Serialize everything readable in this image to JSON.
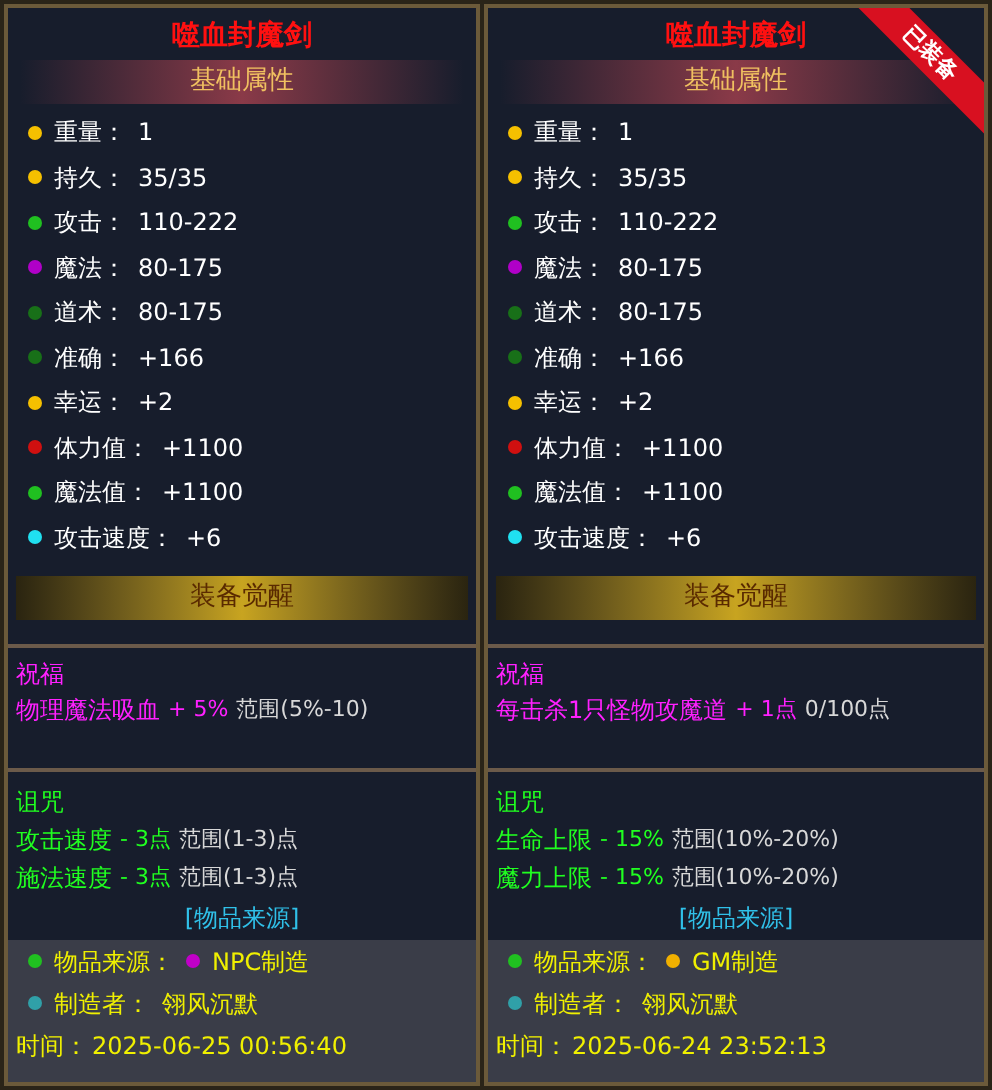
{
  "panels": [
    {
      "title": "噬血封魔剑",
      "basic_header": "基础属性",
      "stats": [
        {
          "label": "重量：",
          "value": "1",
          "color": "#f5c000"
        },
        {
          "label": "持久：",
          "value": "35/35",
          "color": "#f5c000"
        },
        {
          "label": "攻击：",
          "value": "110-222",
          "color": "#20c020"
        },
        {
          "label": "魔法：",
          "value": "80-175",
          "color": "#b000c8"
        },
        {
          "label": "道术：",
          "value": "80-175",
          "color": "#187018"
        },
        {
          "label": "准确：",
          "value": "+166",
          "color": "#187018"
        },
        {
          "label": "幸运：",
          "value": "+2",
          "color": "#f5c000"
        },
        {
          "label": "体力值：",
          "value": "+1100",
          "color": "#d01010"
        },
        {
          "label": "魔法值：",
          "value": "+1100",
          "color": "#20c020"
        },
        {
          "label": "攻击速度：",
          "value": "+6",
          "color": "#20e0f0"
        }
      ],
      "awakening": "装备觉醒",
      "blessing": {
        "title": "祝福",
        "lines": [
          {
            "effect": "物理魔法吸血",
            "amount": "+ 5%",
            "range": "范围(5%-10)"
          }
        ]
      },
      "curse": {
        "title": "诅咒",
        "lines": [
          {
            "effect": "攻击速度",
            "amount": "- 3点",
            "range": "范围(1-3)点"
          },
          {
            "effect": "施法速度",
            "amount": "- 3点",
            "range": "范围(1-3)点"
          }
        ]
      },
      "source_header": "[物品来源]",
      "source": [
        {
          "label": "物品来源：",
          "color": "#20c020",
          "value_tag": {
            "text": "NPC制造",
            "color": "#c000c8"
          }
        },
        {
          "label": "制造者：",
          "value": "翎风沉默",
          "color": "#30a0a8"
        }
      ],
      "time": {
        "label": "时间：",
        "value": "2025-06-25 00:56:40"
      }
    },
    {
      "title": "噬血封魔剑",
      "badge": "已装备",
      "basic_header": "基础属性",
      "stats": [
        {
          "label": "重量：",
          "value": "1",
          "color": "#f5c000"
        },
        {
          "label": "持久：",
          "value": "35/35",
          "color": "#f5c000"
        },
        {
          "label": "攻击：",
          "value": "110-222",
          "color": "#20c020"
        },
        {
          "label": "魔法：",
          "value": "80-175",
          "color": "#b000c8"
        },
        {
          "label": "道术：",
          "value": "80-175",
          "color": "#187018"
        },
        {
          "label": "准确：",
          "value": "+166",
          "color": "#187018"
        },
        {
          "label": "幸运：",
          "value": "+2",
          "color": "#f5c000"
        },
        {
          "label": "体力值：",
          "value": "+1100",
          "color": "#d01010"
        },
        {
          "label": "魔法值：",
          "value": "+1100",
          "color": "#20c020"
        },
        {
          "label": "攻击速度：",
          "value": "+6",
          "color": "#20e0f0"
        }
      ],
      "awakening": "装备觉醒",
      "blessing": {
        "title": "祝福",
        "lines": [
          {
            "effect": "每击杀1只怪物攻魔道",
            "amount": "+ 1点",
            "range": "0/100点"
          }
        ]
      },
      "curse": {
        "title": "诅咒",
        "lines": [
          {
            "effect": "生命上限",
            "amount": "- 15%",
            "range": "范围(10%-20%)"
          },
          {
            "effect": "魔力上限",
            "amount": "- 15%",
            "range": "范围(10%-20%)"
          }
        ]
      },
      "source_header": "[物品来源]",
      "source": [
        {
          "label": "物品来源：",
          "color": "#20c020",
          "value_tag": {
            "text": "GM制造",
            "color": "#f0b000"
          }
        },
        {
          "label": "制造者：",
          "value": "翎风沉默",
          "color": "#30a0a8"
        }
      ],
      "time": {
        "label": "时间：",
        "value": "2025-06-24 23:52:13"
      }
    }
  ]
}
